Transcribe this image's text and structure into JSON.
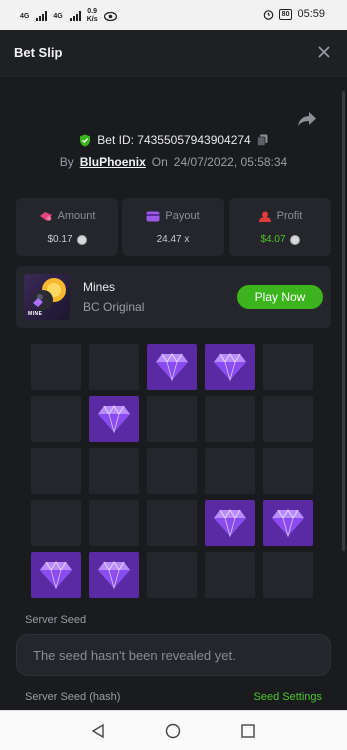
{
  "status_bar": {
    "sim1": "4G",
    "sim2": "4G",
    "speed_value": "0.9",
    "speed_unit": "K/s",
    "battery": "80",
    "time": "05:59"
  },
  "header": {
    "title": "Bet Slip"
  },
  "bet": {
    "id_label": "Bet ID: 74355057943904274",
    "by_label": "By",
    "username": "BluPhoenix",
    "on_label": "On",
    "datetime": "24/07/2022, 05:58:34"
  },
  "stats": {
    "amount_label": "Amount",
    "amount_value": "$0.17",
    "payout_label": "Payout",
    "payout_value": "24.47 x",
    "profit_label": "Profit",
    "profit_value": "$4.07"
  },
  "game": {
    "name": "Mines",
    "subtitle": "BC Original",
    "thumb_text": "MINE",
    "play_label": "Play Now"
  },
  "mines_grid": {
    "rows": 5,
    "cols": 5,
    "tiles": [
      [
        "empty",
        "empty",
        "gem",
        "gem",
        "empty"
      ],
      [
        "empty",
        "gem",
        "empty",
        "empty",
        "empty"
      ],
      [
        "empty",
        "empty",
        "empty",
        "empty",
        "empty"
      ],
      [
        "empty",
        "empty",
        "empty",
        "gem",
        "gem"
      ],
      [
        "gem",
        "gem",
        "empty",
        "empty",
        "empty"
      ]
    ]
  },
  "seeds": {
    "server_seed_label": "Server Seed",
    "server_seed_value": "The seed hasn't been revealed yet.",
    "server_seed_hash_label": "Server Seed (hash)",
    "seed_settings_label": "Seed Settings"
  },
  "colors": {
    "background": "#1a1b1f",
    "card": "#25262b",
    "gem_tile": "#5a2aa3",
    "accent_green": "#3cb41d",
    "amount_icon": "#e0457b",
    "payout_icon": "#9b59e6",
    "profit_icon": "#e03a3a"
  }
}
